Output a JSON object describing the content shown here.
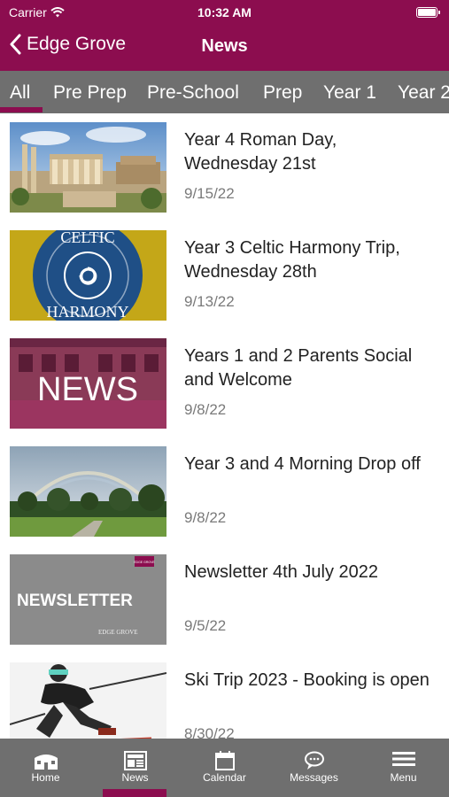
{
  "status_bar": {
    "carrier": "Carrier",
    "time": "10:32 AM"
  },
  "nav": {
    "back_label": "Edge Grove",
    "title": "News"
  },
  "tabs": [
    {
      "label": "All",
      "active": true
    },
    {
      "label": "Pre Prep"
    },
    {
      "label": "Pre-School"
    },
    {
      "label": "Prep"
    },
    {
      "label": "Year 1"
    },
    {
      "label": "Year 2"
    }
  ],
  "news": [
    {
      "title": "Year 4 Roman Day, Wednesday 21st",
      "date": "9/15/22",
      "image": "roman-forum-photo"
    },
    {
      "title": "Year 3 Celtic Harmony Trip, Wednesday 28th",
      "date": "9/13/22",
      "image": "celtic-harmony-logo",
      "image_text_top": "CELTIC",
      "image_text_bottom": "HARMONY"
    },
    {
      "title": "Years 1 and 2 Parents Social and Welcome",
      "date": "9/8/22",
      "image": "news-graphic",
      "image_text": "NEWS"
    },
    {
      "title": "Year 3 and 4 Morning Drop off",
      "date": "9/8/22",
      "image": "rainbow-field-photo"
    },
    {
      "title": "Newsletter 4th July 2022",
      "date": "9/5/22",
      "image": "newsletter-graphic",
      "image_text": "NEWSLETTER",
      "image_small_text": "EDGE GROVE",
      "image_badge_text": "EDGE GROVE"
    },
    {
      "title": "Ski Trip 2023 - Booking is open",
      "date": "8/30/22",
      "image": "skier-photo"
    }
  ],
  "tabbar": [
    {
      "label": "Home",
      "icon": "home-icon"
    },
    {
      "label": "News",
      "icon": "news-icon",
      "active": true
    },
    {
      "label": "Calendar",
      "icon": "calendar-icon"
    },
    {
      "label": "Messages",
      "icon": "messages-icon"
    },
    {
      "label": "Menu",
      "icon": "menu-icon"
    }
  ],
  "colors": {
    "brand": "#8c0d4f",
    "bar_gray": "#6f6f6f",
    "date_gray": "#7a7a7a"
  }
}
